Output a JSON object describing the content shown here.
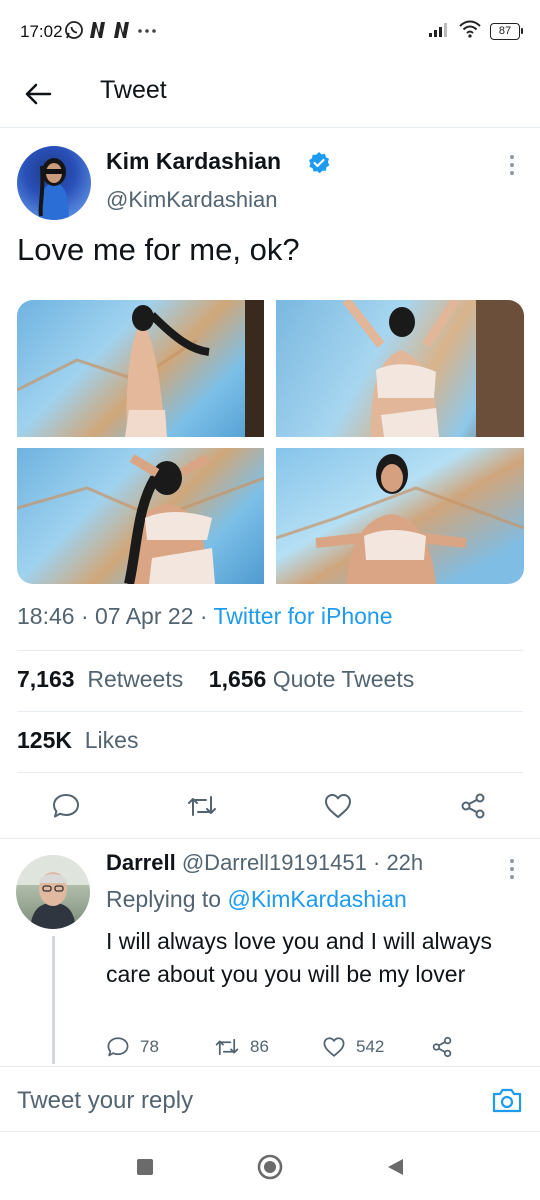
{
  "status_bar": {
    "time": "17:02",
    "battery": "87",
    "icons_left": [
      "whatsapp-icon",
      "netflix-icon",
      "netflix-icon",
      "more-dots-icon"
    ],
    "icons_right": [
      "signal-icon",
      "wifi-icon",
      "battery-icon"
    ]
  },
  "header": {
    "title": "Tweet",
    "back_icon": "arrow-left-icon"
  },
  "tweet": {
    "author_name": "Kim Kardashian",
    "author_handle": "@KimKardashian",
    "verified": true,
    "text": "Love me for me, ok?",
    "photo_count": 4,
    "time": "18:46",
    "date": "07 Apr 22",
    "source": "Twitter for iPhone",
    "retweets_count": "7,163",
    "retweets_label": "Retweets",
    "quote_count": "1,656",
    "quote_label": "Quote Tweets",
    "likes_count": "125K",
    "likes_label": "Likes"
  },
  "reply": {
    "author_name": "Darrell",
    "author_handle": "@Darrell19191451",
    "age": "22h",
    "replying_label": "Replying to",
    "replying_handle": "@KimKardashian",
    "text": "I will always love you and I will always care about you you will be my lover",
    "replies": "78",
    "retweets": "86",
    "likes": "542"
  },
  "composer": {
    "placeholder": "Tweet your reply"
  },
  "colors": {
    "accent": "#1d9bf0",
    "text_primary": "#0f1419",
    "text_secondary": "#536471",
    "divider": "#e6ecf0"
  }
}
